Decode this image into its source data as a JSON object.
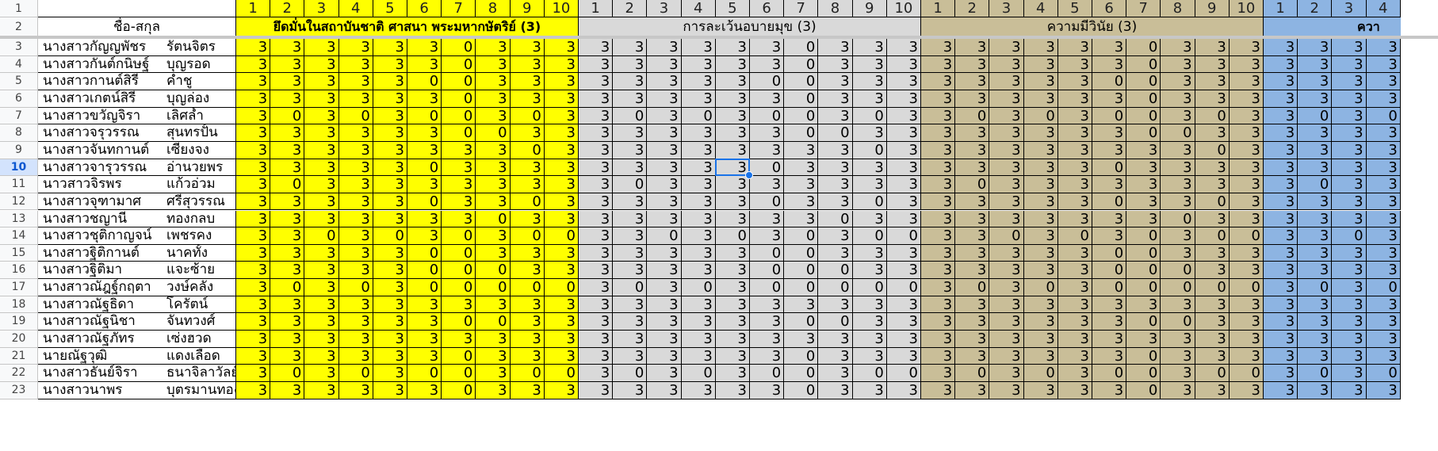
{
  "sheet": {
    "active_row": "10",
    "name_header": "ชื่อ-สกุล",
    "groups": [
      {
        "title": "ยึดมั่นในสถาบันชาติ ศาสนา พระมหากษัตริย์ (3)",
        "color": "#ffff00",
        "bold": true,
        "cols": [
          "1",
          "2",
          "3",
          "4",
          "5",
          "6",
          "7",
          "8",
          "9",
          "10"
        ]
      },
      {
        "title": "การละเว้นอบายมุข (3)",
        "color": "#d9d9d9",
        "bold": false,
        "cols": [
          "1",
          "2",
          "3",
          "4",
          "5",
          "6",
          "7",
          "8",
          "9",
          "10"
        ]
      },
      {
        "title": "ความมีวินัย (3)",
        "color": "#c9be98",
        "bold": false,
        "cols": [
          "1",
          "2",
          "3",
          "4",
          "5",
          "6",
          "7",
          "8",
          "9",
          "10"
        ]
      },
      {
        "title": "ควา",
        "color": "#8db4e2",
        "bold": true,
        "cols": [
          "1",
          "2",
          "3",
          "4"
        ]
      }
    ],
    "rows": [
      {
        "num": "3",
        "first": "นางสาวกัญญพัชร",
        "last": "รัตนจิตร",
        "v": [
          "3",
          "3",
          "3",
          "3",
          "3",
          "3",
          "0",
          "3",
          "3",
          "3"
        ]
      },
      {
        "num": "4",
        "first": "นางสาวกันต์กนิษฐ์",
        "last": "บุญรอด",
        "v": [
          "3",
          "3",
          "3",
          "3",
          "3",
          "3",
          "0",
          "3",
          "3",
          "3"
        ]
      },
      {
        "num": "5",
        "first": "นางสาวกานต์สิรี",
        "last": "คำชู",
        "v": [
          "3",
          "3",
          "3",
          "3",
          "3",
          "0",
          "0",
          "3",
          "3",
          "3"
        ]
      },
      {
        "num": "6",
        "first": "นางสาวเกตน์สิรี",
        "last": "บุญล่อง",
        "v": [
          "3",
          "3",
          "3",
          "3",
          "3",
          "3",
          "0",
          "3",
          "3",
          "3"
        ]
      },
      {
        "num": "7",
        "first": "นางสาวขวัญจิรา",
        "last": "เลิศล้ำ",
        "v": [
          "3",
          "0",
          "3",
          "0",
          "3",
          "0",
          "0",
          "3",
          "0",
          "3"
        ]
      },
      {
        "num": "8",
        "first": "นางสาวจรุวรรณ",
        "last": "สุนทรปั้น",
        "v": [
          "3",
          "3",
          "3",
          "3",
          "3",
          "3",
          "0",
          "0",
          "3",
          "3"
        ]
      },
      {
        "num": "9",
        "first": "นางสาวจันทกานต์",
        "last": "เซี่ยงจง",
        "v": [
          "3",
          "3",
          "3",
          "3",
          "3",
          "3",
          "3",
          "3",
          "0",
          "3"
        ]
      },
      {
        "num": "10",
        "first": "นางสาวจารุวรรณ",
        "last": "อ่านวยพร",
        "v": [
          "3",
          "3",
          "3",
          "3",
          "3",
          "0",
          "3",
          "3",
          "3",
          "3"
        ]
      },
      {
        "num": "11",
        "first": "นาวสาวจิรพร",
        "last": "แก้วอ่วม",
        "v": [
          "3",
          "0",
          "3",
          "3",
          "3",
          "3",
          "3",
          "3",
          "3",
          "3"
        ]
      },
      {
        "num": "12",
        "first": "นางสาวจุฑามาศ",
        "last": "ศรีสุวรรณ",
        "v": [
          "3",
          "3",
          "3",
          "3",
          "3",
          "0",
          "3",
          "3",
          "0",
          "3"
        ]
      },
      {
        "num": "13",
        "first": "นางสาวชญานี",
        "last": "ทองกลบ",
        "v": [
          "3",
          "3",
          "3",
          "3",
          "3",
          "3",
          "3",
          "0",
          "3",
          "3"
        ]
      },
      {
        "num": "14",
        "first": "นางสาวชุติกาญจน์",
        "last": "เพชรคง",
        "v": [
          "3",
          "3",
          "0",
          "3",
          "0",
          "3",
          "0",
          "3",
          "0",
          "0"
        ]
      },
      {
        "num": "15",
        "first": "นางสาวฐิติกานต์",
        "last": "นาคทั้ง",
        "v": [
          "3",
          "3",
          "3",
          "3",
          "3",
          "0",
          "0",
          "3",
          "3",
          "3"
        ]
      },
      {
        "num": "16",
        "first": "นางสาวฐิติมา",
        "last": "แจะซ้าย",
        "v": [
          "3",
          "3",
          "3",
          "3",
          "3",
          "0",
          "0",
          "0",
          "3",
          "3"
        ]
      },
      {
        "num": "17",
        "first": "นางสาวณัฎฐ์กฤตา",
        "last": "วงษ์คลัง",
        "v": [
          "3",
          "0",
          "3",
          "0",
          "3",
          "0",
          "0",
          "0",
          "0",
          "0"
        ]
      },
      {
        "num": "18",
        "first": "นางสาวณัฐธิดา",
        "last": "โครัตน์",
        "v": [
          "3",
          "3",
          "3",
          "3",
          "3",
          "3",
          "3",
          "3",
          "3",
          "3"
        ]
      },
      {
        "num": "19",
        "first": "นางสาวณัฐนิชา",
        "last": "จันทวงศ์",
        "v": [
          "3",
          "3",
          "3",
          "3",
          "3",
          "3",
          "0",
          "0",
          "3",
          "3"
        ]
      },
      {
        "num": "20",
        "first": "นางสาวณัฐภัทร",
        "last": "เซ่งฮวด",
        "v": [
          "3",
          "3",
          "3",
          "3",
          "3",
          "3",
          "3",
          "3",
          "3",
          "3"
        ]
      },
      {
        "num": "21",
        "first": "นายณัฐวุฒิ",
        "last": "แดงเลือด",
        "v": [
          "3",
          "3",
          "3",
          "3",
          "3",
          "3",
          "0",
          "3",
          "3",
          "3"
        ]
      },
      {
        "num": "22",
        "first": "นางสาวธันย์จิรา",
        "last": "ธนาจิลาวัลย์",
        "v": [
          "3",
          "0",
          "3",
          "0",
          "3",
          "0",
          "0",
          "3",
          "0",
          "0"
        ]
      },
      {
        "num": "23",
        "first": "นางสาวนาพร",
        "last": "บุตรมานทอง",
        "v": [
          "3",
          "3",
          "3",
          "3",
          "3",
          "3",
          "0",
          "3",
          "3",
          "3"
        ]
      }
    ]
  }
}
